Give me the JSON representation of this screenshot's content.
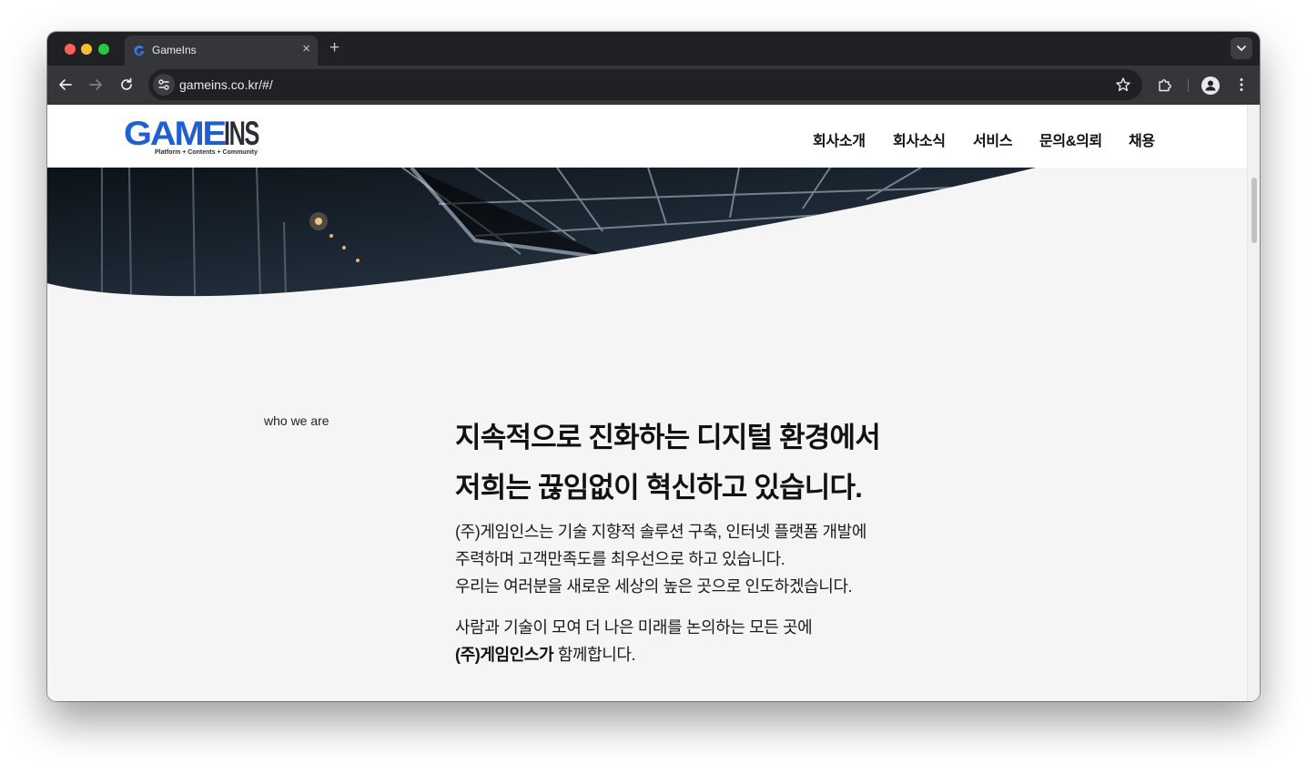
{
  "browser": {
    "tab_title": "GameIns",
    "url": "gameins.co.kr/#/"
  },
  "site": {
    "logo_main": "GAMEINS",
    "logo_sub": "Platform + Contents + Community",
    "nav": [
      "회사소개",
      "회사소식",
      "서비스",
      "문의&의뢰",
      "채용"
    ]
  },
  "about": {
    "section_label": "who we are",
    "headline_line1_plain": "지속적으로 진화하는 ",
    "headline_line1_highlight": "디지털 환경에서",
    "headline_line2_plain": "저희는 ",
    "headline_line2_highlight": "끊임없이 혁신하고 있습니다.",
    "para1": [
      "(주)게임인스는 기술 지향적 솔루션 구축, 인터넷 플랫폼 개발에",
      "주력하며 고객만족도를 최우선으로 하고 있습니다.",
      "우리는 여러분을 새로운 세상의 높은 곳으로 인도하겠습니다."
    ],
    "para2_line1": "사람과 기술이 모여 더 나은 미래를 논의하는 모든 곳에",
    "para2_bold": "(주)게임인스가",
    "para2_rest": " 함께합니다."
  },
  "colors": {
    "highlight": "#0a6ef4",
    "logo_blue": "#1f5fd0",
    "browser_dark": "#202124"
  }
}
